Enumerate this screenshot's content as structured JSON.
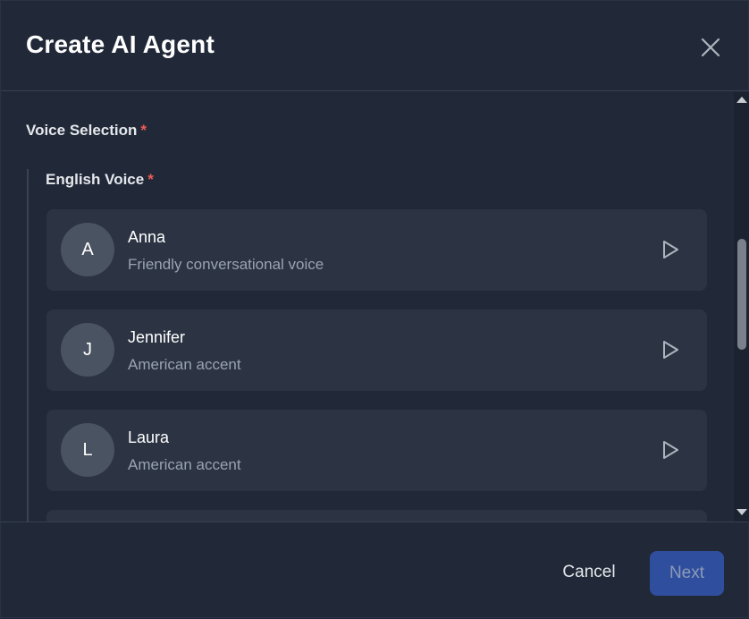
{
  "dialog": {
    "title": "Create AI Agent"
  },
  "voice_selection": {
    "label": "Voice Selection",
    "required_mark": "*",
    "english": {
      "label": "English Voice",
      "required_mark": "*",
      "voices": [
        {
          "initial": "A",
          "name": "Anna",
          "description": "Friendly conversational voice"
        },
        {
          "initial": "J",
          "name": "Jennifer",
          "description": "American accent"
        },
        {
          "initial": "L",
          "name": "Laura",
          "description": "American accent"
        }
      ]
    }
  },
  "footer": {
    "cancel_label": "Cancel",
    "next_label": "Next"
  },
  "colors": {
    "background": "#212938",
    "card": "#2c3443",
    "required": "#ef5b5b",
    "primary_button": "#2f4f9e"
  },
  "icons": {
    "close": "close-icon",
    "play": "play-icon"
  }
}
